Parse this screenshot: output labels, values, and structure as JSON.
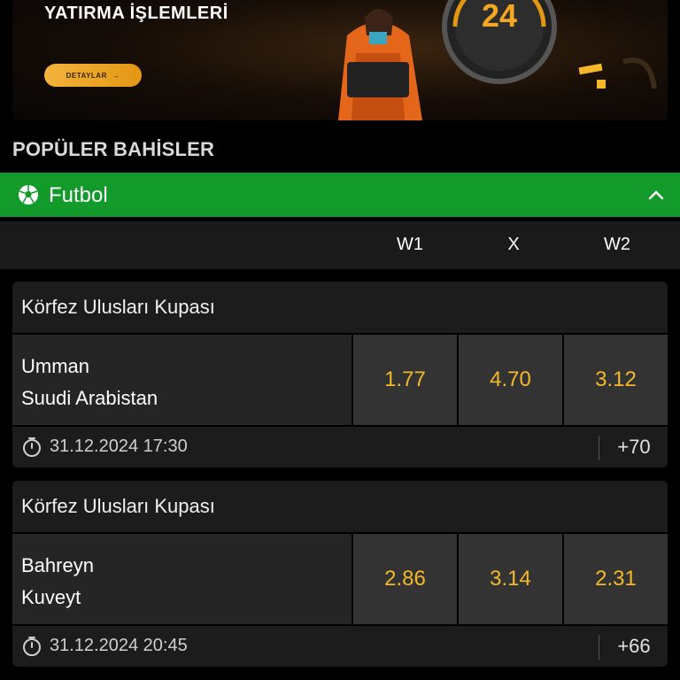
{
  "banner": {
    "title": "YATIRMA İŞLEMLERİ",
    "button_label": "DETAYLAR",
    "button_arrow": "→",
    "clock_text": "24"
  },
  "section": {
    "title": "POPÜLER BAHİSLER"
  },
  "sport": {
    "label": "Futbol",
    "icon": "soccer-ball-icon",
    "accent": "#129b2b"
  },
  "columns": {
    "w1": "W1",
    "x": "X",
    "w2": "W2"
  },
  "events": [
    {
      "league": "Körfez Ulusları Kupası",
      "team1": "Umman",
      "team2": "Suudi Arabistan",
      "odds": {
        "w1": "1.77",
        "x": "4.70",
        "w2": "3.12"
      },
      "datetime": "31.12.2024 17:30",
      "more": "+70"
    },
    {
      "league": "Körfez Ulusları Kupası",
      "team1": "Bahreyn",
      "team2": "Kuveyt",
      "odds": {
        "w1": "2.86",
        "x": "3.14",
        "w2": "2.31"
      },
      "datetime": "31.12.2024 20:45",
      "more": "+66"
    }
  ],
  "colors": {
    "odd_text": "#f5b82a",
    "accent_orange": "#e39712"
  }
}
